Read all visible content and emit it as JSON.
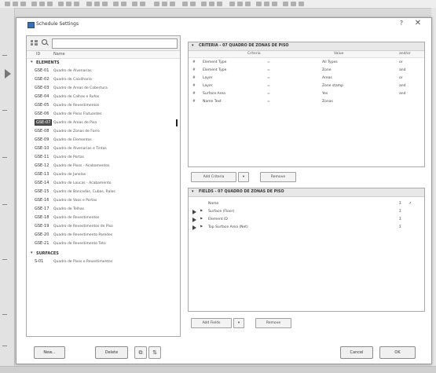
{
  "dialog": {
    "title": "Schedule Settings",
    "help_glyph": "?",
    "close_glyph": "✕"
  },
  "left": {
    "headers": {
      "id": "ID",
      "name": "Name"
    },
    "groups": [
      {
        "label": "ELEMENTS",
        "chevron": "▾"
      },
      {
        "label": "SURFACES",
        "chevron": "▾"
      }
    ],
    "items": [
      {
        "id": "GSE-01",
        "name": "Quadro de Alvenarias"
      },
      {
        "id": "GSE-02",
        "name": "Quadro de Caixilharia"
      },
      {
        "id": "GSE-03",
        "name": "Quadro de Areas de Cobertura"
      },
      {
        "id": "GSE-04",
        "name": "Quadro de Calhas e Rufos"
      },
      {
        "id": "GSE-05",
        "name": "Quadro de Revestimentos"
      },
      {
        "id": "GSE-06",
        "name": "Quadro de Pisos Flutuantes"
      },
      {
        "id": "GSE-07",
        "name": "Quadro de Areas de Piso"
      },
      {
        "id": "GSE-08",
        "name": "Quadro de Zonas de Forro"
      },
      {
        "id": "GSE-09",
        "name": "Quadro de Elementos"
      },
      {
        "id": "GSE-10",
        "name": "Quadro de Alvenarias e Tintas"
      },
      {
        "id": "GSE-11",
        "name": "Quadro de Portas"
      },
      {
        "id": "GSE-12",
        "name": "Quadro de Pisos - Acabamentos"
      },
      {
        "id": "GSE-13",
        "name": "Quadro de Janelas"
      },
      {
        "id": "GSE-14",
        "name": "Quadro de Loucas - Acabamento"
      },
      {
        "id": "GSE-15",
        "name": "Quadro de Bancadas, Cubas, Ralos"
      },
      {
        "id": "GSE-16",
        "name": "Quadro de Vaos e Portas"
      },
      {
        "id": "GSE-17",
        "name": "Quadro de Telhas"
      },
      {
        "id": "GSE-18",
        "name": "Quadro de Revestimentos"
      },
      {
        "id": "GSE-19",
        "name": "Quadro de Revestimentos de Piso"
      },
      {
        "id": "GSE-20",
        "name": "Quadro de Revestimento Paredes"
      },
      {
        "id": "GSE-21",
        "name": "Quadro de Revestimento Teto"
      }
    ],
    "surface_items": [
      {
        "id": "S-01",
        "name": "Quadro de Pisos e Revestimentos"
      }
    ]
  },
  "criteria": {
    "header": "CRITERIA - 07 QUADRO DE ZONAS DE PISO",
    "chevron": "▾",
    "columns": {
      "criteria": "Criteria",
      "value": "Value",
      "and_or": "and/or"
    },
    "rows": [
      {
        "c1": "#",
        "field": "Element Type",
        "op": "=",
        "value": "All Types",
        "andor": "or"
      },
      {
        "c1": "#",
        "field": "Element Type",
        "op": "=",
        "value": "Zone",
        "andor": "and"
      },
      {
        "c1": "#",
        "field": "Layer",
        "op": "=",
        "value": "Areas",
        "andor": "or"
      },
      {
        "c1": "#",
        "field": "Layer",
        "op": "=",
        "value": "Zone stamp",
        "andor": "and"
      },
      {
        "c1": "#",
        "field": "Surface Area",
        "op": "=",
        "value": "Yes",
        "andor": "and"
      },
      {
        "c1": "#",
        "field": "Name Text",
        "op": "=",
        "value": "Zonas",
        "andor": ""
      }
    ],
    "add_button": "Add Criteria",
    "add_arrow": "▾",
    "remove_button": "Remove"
  },
  "fields": {
    "header": "FIELDS - 07 QUADRO DE ZONAS DE PISO",
    "chevron": "▾",
    "rows": [
      {
        "name": "Name",
        "flag": "Σ",
        "extra": "↗"
      },
      {
        "name": "Surface (Floor)",
        "flag": "Σ",
        "extra": ""
      },
      {
        "name": "Element ID",
        "flag": "Σ",
        "extra": ""
      },
      {
        "name": "Top Surface Area (Net)",
        "flag": "Σ",
        "extra": ""
      }
    ],
    "add_button": "Add Fields",
    "add_arrow": "▾",
    "remove_button": "Remove"
  },
  "footer": {
    "new_button": "New...",
    "delete_button": "Delete",
    "icon1": "⧉",
    "icon2": "⇅",
    "cancel_button": "Cancel",
    "ok_button": "OK"
  }
}
